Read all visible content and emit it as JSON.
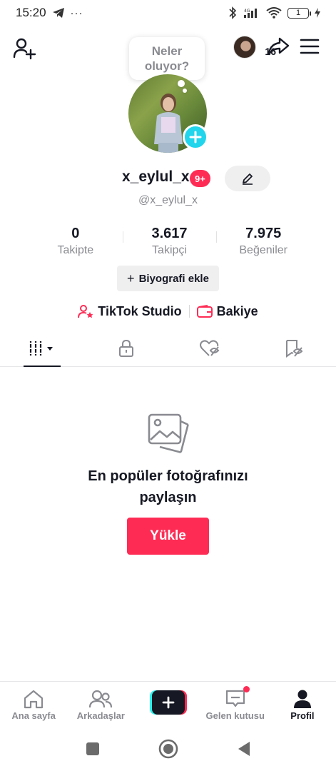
{
  "status_bar": {
    "time": "15:20",
    "dots": "···",
    "battery_level": "1"
  },
  "header": {
    "bubble_text_line1": "Neler",
    "bubble_text_line2": "oluyor?",
    "visitor_count": "16"
  },
  "profile": {
    "username": "x_eylul_x",
    "badge": "9+",
    "handle": "@x_eylul_x"
  },
  "stats": [
    {
      "value": "0",
      "label": "Takipte"
    },
    {
      "value": "3.617",
      "label": "Takipçi"
    },
    {
      "value": "7.975",
      "label": "Beğeniler"
    }
  ],
  "bio_button": {
    "plus": "+",
    "label": "Biyografi ekle"
  },
  "links": {
    "studio": "TikTok Studio",
    "balance": "Bakiye"
  },
  "tabs": [
    {
      "icon": "grid-icon",
      "active": true
    },
    {
      "icon": "lock-icon",
      "active": false
    },
    {
      "icon": "liked-icon",
      "active": false
    },
    {
      "icon": "bookmark-icon",
      "active": false
    }
  ],
  "empty_state": {
    "title_line1": "En popüler fotoğrafınızı",
    "title_line2": "paylaşın",
    "button": "Yükle"
  },
  "bottom_nav": [
    {
      "label": "Ana sayfa"
    },
    {
      "label": "Arkadaşlar"
    },
    {
      "label": ""
    },
    {
      "label": "Gelen kutusu"
    },
    {
      "label": "Profil"
    }
  ],
  "colors": {
    "accent": "#fe2c55",
    "cyan": "#20d5ec",
    "text": "#161823",
    "muted": "#8a8b91"
  }
}
